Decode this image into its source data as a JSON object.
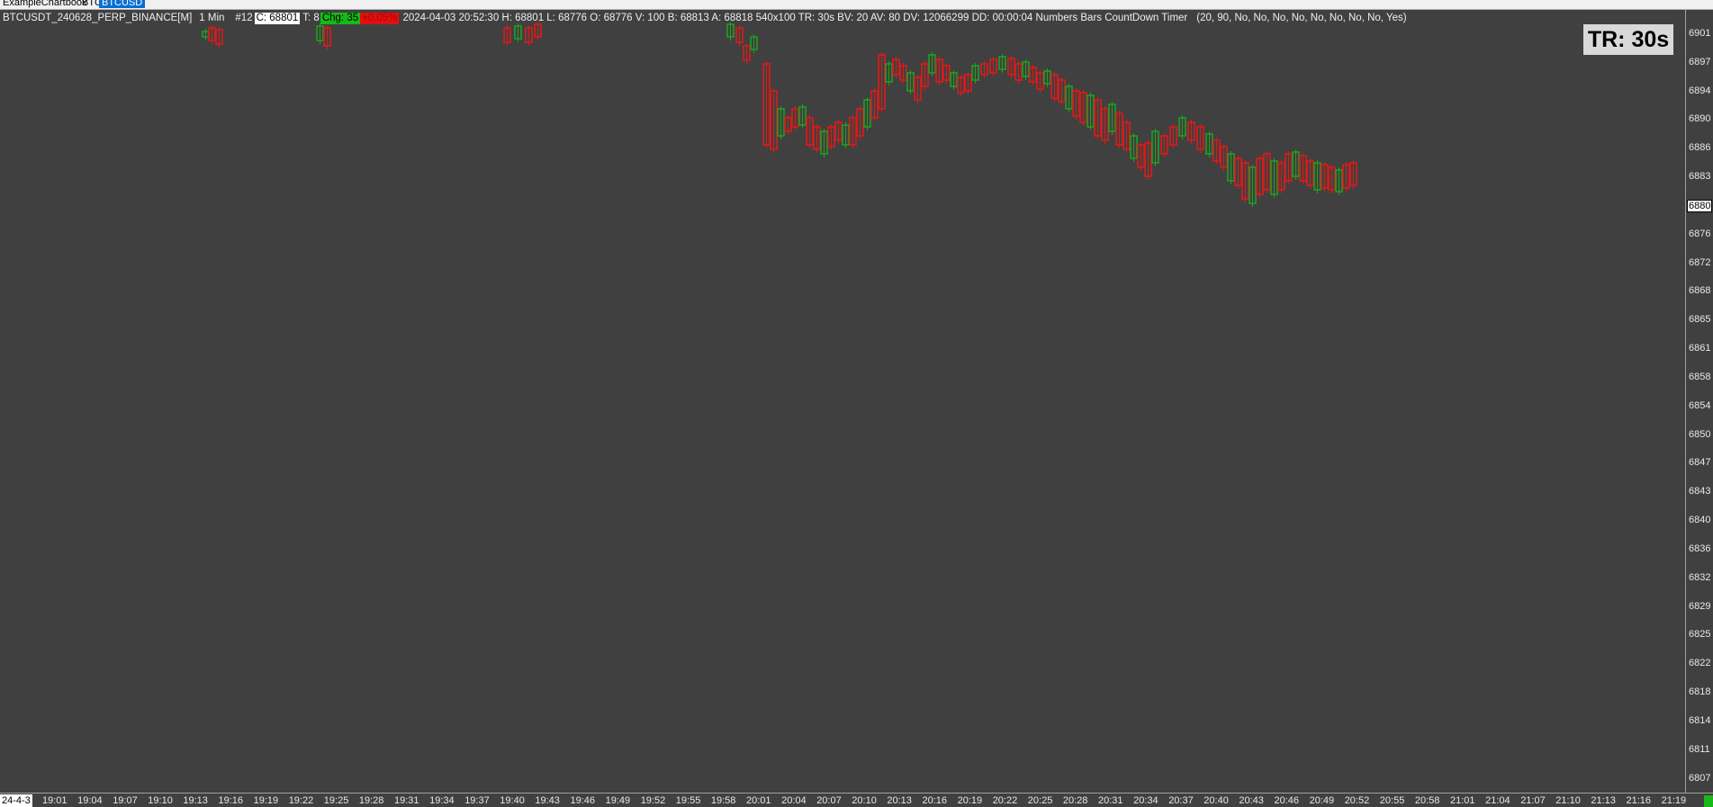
{
  "tabs": [
    {
      "label": "ExampleChartbook",
      "active": false
    },
    {
      "label": "BTC",
      "active": false
    },
    {
      "label": "BTCUSD",
      "active": true
    }
  ],
  "header": {
    "symbol": "BTCUSDT_240628_PERP_BINANCE[M]",
    "interval": "1 Min",
    "bar_number": "#12",
    "close_box": "C: 68801",
    "ticks": "T: 8",
    "chg_box": "Chg: 35",
    "red_box": "+0.05%",
    "stats": "2024-04-03 20:52:30 H: 68801 L: 68776 O: 68776 V: 100 B: 68813 A: 68818 540x100 TR: 30s BV: 20 AV: 80 DV: 12066299 DD: 00:00:04 Numbers Bars  CountDown Timer",
    "params": "(20, 90, No, No, No, No, No, No, No, No, Yes)"
  },
  "timer_label": "TR: 30s",
  "price_axis": {
    "labels": [
      "6901",
      "6897",
      "6894",
      "6890",
      "6886",
      "6883",
      "6880",
      "6876",
      "6872",
      "6868",
      "6865",
      "6861",
      "6858",
      "6854",
      "6850",
      "6847",
      "6843",
      "6840",
      "6836",
      "6832",
      "6829",
      "6825",
      "6822",
      "6818",
      "6814",
      "6811",
      "6807"
    ],
    "current_index": 6
  },
  "time_axis": {
    "date": "24-4-3",
    "labels": [
      "19:01",
      "19:04",
      "19:07",
      "19:10",
      "19:13",
      "19:16",
      "19:19",
      "19:22",
      "19:25",
      "19:28",
      "19:31",
      "19:34",
      "19:37",
      "19:40",
      "19:43",
      "19:46",
      "19:49",
      "19:52",
      "19:55",
      "19:58",
      "20:01",
      "20:04",
      "20:07",
      "20:10",
      "20:13",
      "20:16",
      "20:19",
      "20:22",
      "20:25",
      "20:28",
      "20:31",
      "20:34",
      "20:37",
      "20:40",
      "20:43",
      "20:46",
      "20:49",
      "20:52",
      "20:55",
      "20:58",
      "21:01",
      "21:04",
      "21:07",
      "21:10",
      "21:13",
      "21:16",
      "21:19"
    ]
  },
  "colors": {
    "background": "#404040",
    "up": "#1fa01f",
    "down": "#e01818",
    "text": "#e8e8e8"
  }
}
